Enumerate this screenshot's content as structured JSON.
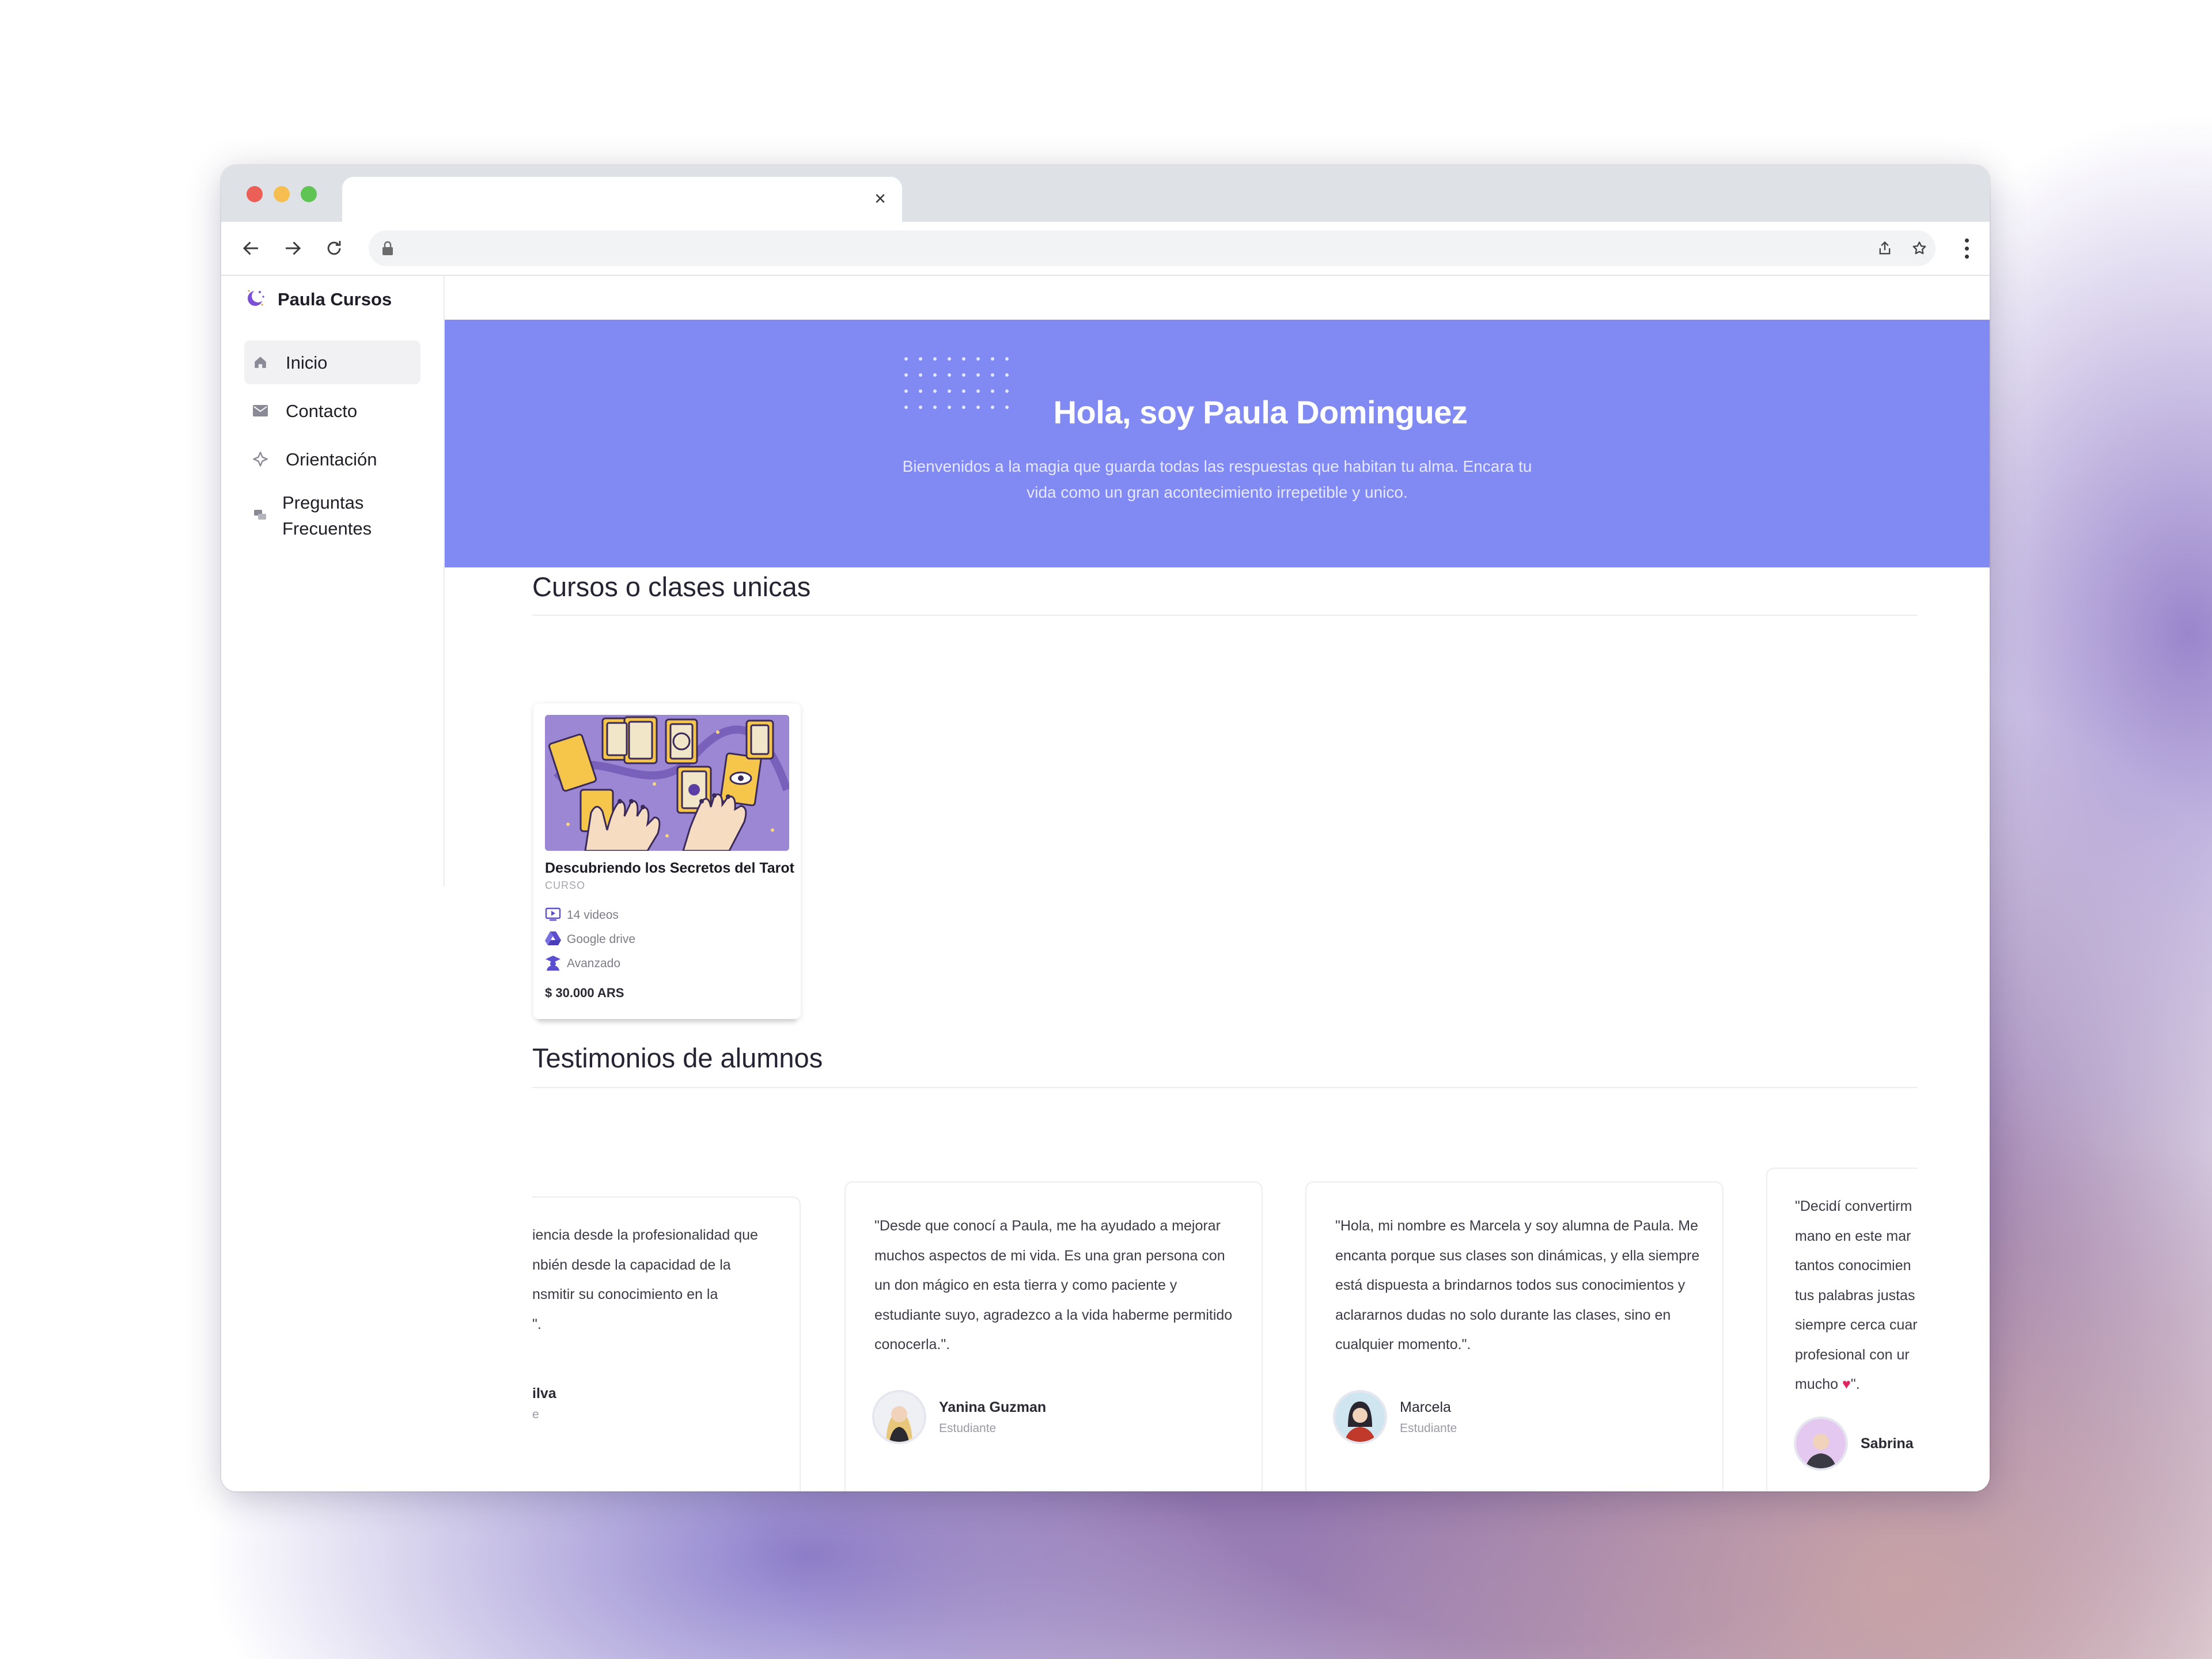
{
  "app": {
    "brand": "Paula Cursos"
  },
  "sidebar": {
    "items": [
      {
        "label": "Inicio",
        "icon": "home-icon"
      },
      {
        "label": "Contacto",
        "icon": "mail-icon"
      },
      {
        "label": "Orientación",
        "icon": "compass-icon"
      },
      {
        "label": "Preguntas Frecuentes",
        "icon": "chat-icon"
      }
    ]
  },
  "hero": {
    "title": "Hola, soy Paula Dominguez",
    "subtitle": "Bienvenidos a la magia que guarda todas las respuestas que habitan tu alma. Encara tu vida como un gran acontecimiento irrepetible y unico."
  },
  "courses": {
    "section_title": "Cursos o clases unicas",
    "items": [
      {
        "title": "Descubriendo los Secretos del Tarot",
        "kind": "CURSO",
        "videos": "14 videos",
        "platform": "Google drive",
        "level": "Avanzado",
        "price": "$ 30.000 ARS"
      }
    ]
  },
  "testimonials": {
    "section_title": "Testimonios de alumnos",
    "items": [
      {
        "quote": "iencia desde la profesionalidad que\nnbién desde la capacidad de la\nnsmitir su conocimiento en la\n\".",
        "name": "ilva",
        "role": "e"
      },
      {
        "quote": "\"Desde que conocí a Paula, me ha ayudado a mejorar muchos aspectos de mi vida. Es una gran persona con un don mágico en esta tierra y como paciente y estudiante suyo, agradezco a la vida haberme permitido conocerla.\".",
        "name": "Yanina Guzman",
        "role": "Estudiante"
      },
      {
        "quote": "\"Hola, mi nombre es Marcela y soy alumna de Paula. Me encanta porque sus clases son dinámicas, y ella siempre está dispuesta a brindarnos todos sus conocimientos y aclararnos dudas no solo durante las clases, sino en cualquier momento.\".",
        "name": "Marcela",
        "role": "Estudiante"
      },
      {
        "quote": "\"Decidí convertirm\nmano en este mar\ntantos conocimien\ntus palabras justas\nsiempre cerca cuar\nprofesional con ur\nmucho",
        "quote_end": "\".",
        "name": "Sabrina",
        "role": ""
      }
    ]
  },
  "colors": {
    "accent": "#8189f3",
    "brand_purple": "#7b4fd6",
    "heart": "#e0245e"
  }
}
